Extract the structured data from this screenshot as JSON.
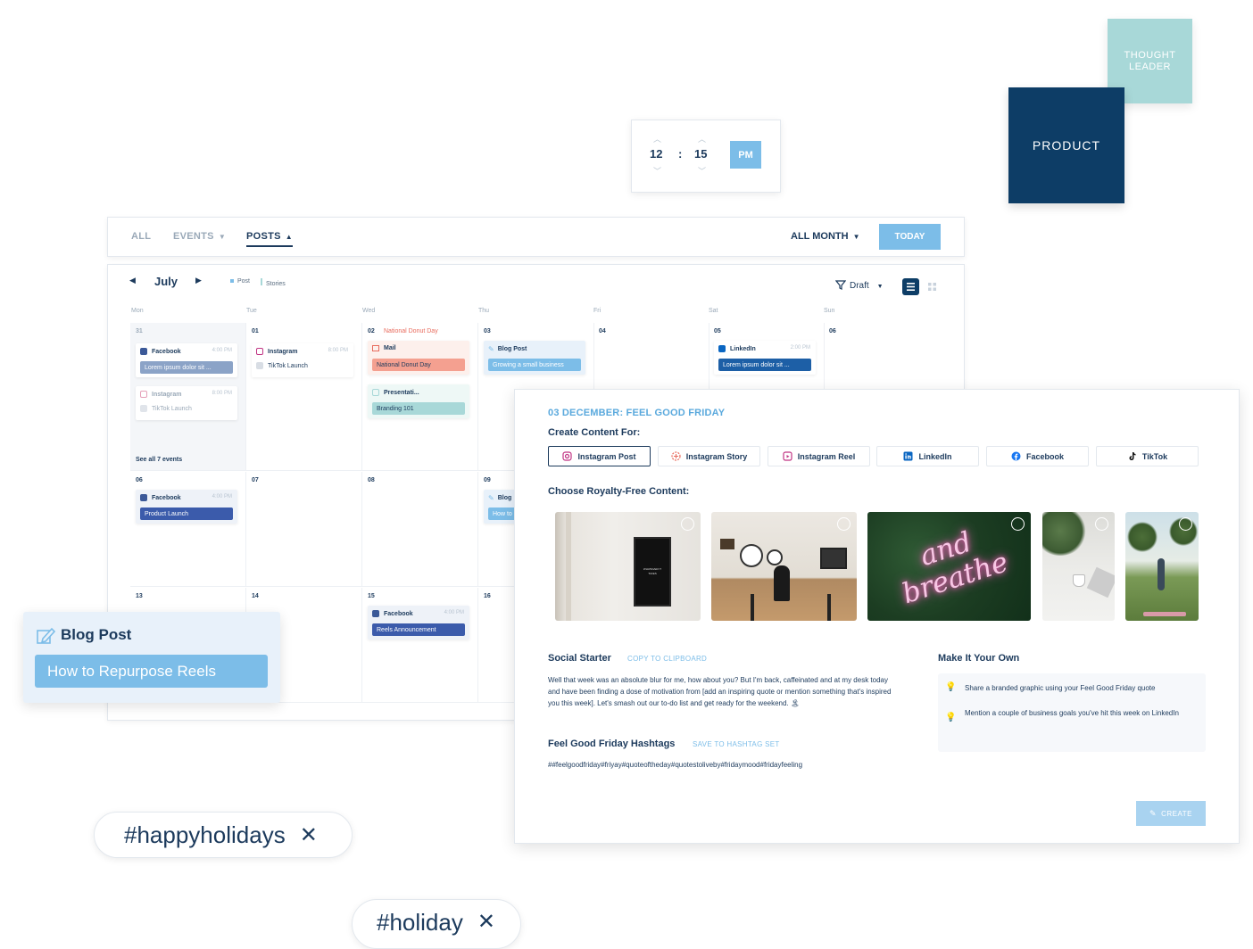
{
  "tags": {
    "product": "PRODUCT",
    "thought_leader": "THOUGHT LEADER"
  },
  "time_picker": {
    "hour": "12",
    "separator": ":",
    "minute": "15",
    "period": "PM"
  },
  "filter_bar": {
    "tabs": [
      {
        "label": "ALL"
      },
      {
        "label": "EVENTS"
      },
      {
        "label": "POSTS"
      }
    ],
    "month_filter": "ALL MONTH",
    "today_label": "TODAY"
  },
  "calendar": {
    "month": "July",
    "legend": [
      {
        "label": "Post",
        "color": "#7cbde8"
      },
      {
        "label": "Stories",
        "color": "#a8d8d8"
      }
    ],
    "filter_label": "Draft",
    "weekdays": [
      "Mon",
      "Tue",
      "Wed",
      "Thu",
      "Fri",
      "Sat",
      "Sun"
    ],
    "week1": {
      "dates": [
        "31",
        "01",
        "02",
        "03",
        "04",
        "05",
        "06"
      ],
      "event_day": "National Donut Day",
      "mon_ev1": {
        "platform": "Facebook",
        "time": "4:00 PM",
        "text": "Lorem ipsum dolor sit ..."
      },
      "mon_ev2": {
        "platform": "Instagram",
        "time": "8:00 PM",
        "text": "TikTok Launch"
      },
      "see_all": "See all 7 events",
      "tue_ev": {
        "platform": "Instagram",
        "time": "8:00 PM",
        "text": "TikTok Launch"
      },
      "wed_ev1": {
        "platform": "Mail",
        "text": "National Donut Day"
      },
      "wed_ev2": {
        "platform": "Presentati...",
        "text": "Branding 101"
      },
      "thu_ev": {
        "platform": "Blog Post",
        "text": "Growing a small business"
      },
      "sat_ev": {
        "platform": "LinkedIn",
        "time": "2:00 PM",
        "text": "Lorem ipsum dolor sit ..."
      }
    },
    "week2": {
      "dates": [
        "06",
        "07",
        "08",
        "09"
      ],
      "mon_ev": {
        "platform": "Facebook",
        "time": "4:00 PM",
        "text": "Product Launch"
      },
      "thu_ev": {
        "platform": "Blog",
        "text": "How to"
      }
    },
    "week3": {
      "dates": [
        "13",
        "14",
        "15",
        "16"
      ],
      "wed_ev": {
        "platform": "Facebook",
        "time": "4:00 PM",
        "text": "Reels Announcement"
      }
    }
  },
  "blog_card": {
    "title": "Blog Post",
    "text": "How to Repurpose Reels"
  },
  "hashtag_pills": [
    {
      "text": "#happyholidays"
    },
    {
      "text": "#holiday"
    }
  ],
  "content_panel": {
    "date_title": "03 DECEMBER: FEEL GOOD FRIDAY",
    "create_for_label": "Create Content For:",
    "platforms": [
      {
        "label": "Instagram Post"
      },
      {
        "label": "Instagram Story"
      },
      {
        "label": "Instagram Reel"
      },
      {
        "label": "LinkedIn"
      },
      {
        "label": "Facebook"
      },
      {
        "label": "TikTok"
      }
    ],
    "royalty_label": "Choose Royalty-Free Content:",
    "photos": [
      {
        "desc": "letter-board-wall",
        "sign": "WHATEVER IT TAKES"
      },
      {
        "desc": "cafe-woman"
      },
      {
        "desc": "neon-sign",
        "neon": "and breathe"
      },
      {
        "desc": "plants-desk"
      },
      {
        "desc": "yoga-palm"
      }
    ],
    "social_starter": {
      "title": "Social Starter",
      "copy_label": "COPY TO CLIPBOARD",
      "text": "Well that week was an absolute blur for me, how about you? But I'm back, caffeinated and at my desk today and have been finding a dose of motivation from [add an inspiring quote or mention something that's inspired you this week]. Let's smash out our to-do list and get ready for the weekend. 🏝"
    },
    "hashtags": {
      "title": "Feel Good Friday Hashtags",
      "save_label": "SAVE TO HASHTAG SET",
      "text": "##feelgoodfriday#friyay#quoteoftheday#quotestoliveby#fridaymood#fridayfeeling"
    },
    "make_own": {
      "title": "Make It Your Own",
      "tips": [
        {
          "text": "Share a branded graphic using your Feel Good Friday quote"
        },
        {
          "text": "Mention a couple of business goals you've hit this week on LinkedIn"
        }
      ]
    },
    "create_label": "CREATE"
  },
  "colors": {
    "navy": "#0d3d66",
    "accent": "#7cbde8",
    "teal": "#a8d8d8",
    "coral": "#f4a090"
  }
}
